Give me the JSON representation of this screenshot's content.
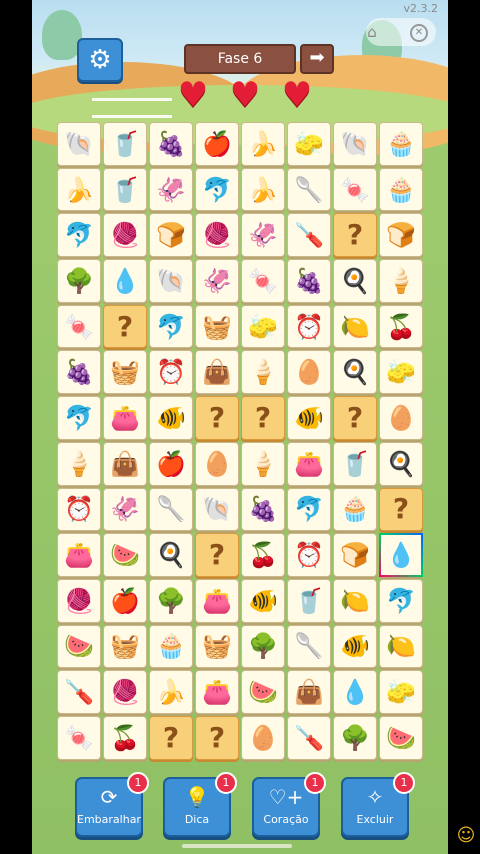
{
  "header": {
    "version": "v2.3.2",
    "level_label": "Fase 6",
    "settings_icon": "gear-icon",
    "next_icon": "arrow-right-icon",
    "hearts": 3
  },
  "board": {
    "rows": 14,
    "cols": 8,
    "tiles": [
      [
        "shell",
        "cup",
        "grapes",
        "apple",
        "banana",
        "sponge",
        "shell",
        "cupcake"
      ],
      [
        "banana",
        "cup",
        "squid",
        "dolphin",
        "banana",
        "spoon",
        "candy",
        "cupcake"
      ],
      [
        "dolphin",
        "yarn",
        "bread",
        "yarn",
        "squid",
        "screwdriver",
        "?",
        "bread"
      ],
      [
        "tree",
        "drop",
        "shell",
        "squid",
        "candy",
        "grapes",
        "pan",
        "popsicle"
      ],
      [
        "candy",
        "?",
        "dolphin",
        "basket",
        "sponge",
        "clock",
        "lemon",
        "cherry"
      ],
      [
        "grapes",
        "basket",
        "clock",
        "sack",
        "popsicle",
        "egg",
        "pan",
        "sponge"
      ],
      [
        "dolphin",
        "purse",
        "fish",
        "?",
        "?",
        "fish",
        "?",
        "egg"
      ],
      [
        "popsicle",
        "sack",
        "apple",
        "egg",
        "popsicle",
        "purse",
        "cup",
        "pan"
      ],
      [
        "clock",
        "squid",
        "spoon",
        "shell",
        "grapes",
        "dolphin",
        "cupcake",
        "?"
      ],
      [
        "purse",
        "melon",
        "pan",
        "?",
        "cherry",
        "clock",
        "bread",
        "drop"
      ],
      [
        "yarn",
        "apple",
        "tree",
        "purse",
        "fish",
        "cup",
        "lemon",
        "dolphin"
      ],
      [
        "melon",
        "basket",
        "cupcake",
        "basket",
        "tree",
        "spoon",
        "fish",
        "lemon"
      ],
      [
        "screwdriver",
        "yarn",
        "banana",
        "purse",
        "melon",
        "sack",
        "drop",
        "sponge"
      ],
      [
        "candy",
        "cherry",
        "?",
        "?",
        "egg",
        "screwdriver",
        "tree",
        "melon"
      ]
    ],
    "selected": [
      9,
      7
    ]
  },
  "icons": {
    "shell": "🐚",
    "cup": "🥤",
    "grapes": "🍇",
    "apple": "🍎",
    "banana": "🍌",
    "sponge": "🧽",
    "cupcake": "🧁",
    "squid": "🦑",
    "dolphin": "🐬",
    "spoon": "🥄",
    "candy": "🍬",
    "yarn": "🧶",
    "bread": "🍞",
    "screwdriver": "🪛",
    "?": "?",
    "tree": "🌳",
    "drop": "💧",
    "popsicle": "🍦",
    "basket": "🧺",
    "sack": "👜",
    "clock": "⏰",
    "lemon": "🍋",
    "cherry": "🍒",
    "pan": "🍳",
    "egg": "🥚",
    "purse": "👛",
    "fish": "🐠",
    "melon": "🍉"
  },
  "powerups": [
    {
      "label": "Embaralhar",
      "count": "1",
      "icon": "shuffle-icon"
    },
    {
      "label": "Dica",
      "count": "1",
      "icon": "lightbulb-icon"
    },
    {
      "label": "Coração",
      "count": "1",
      "icon": "heart-plus-icon"
    },
    {
      "label": "Excluir",
      "count": "1",
      "icon": "magic-wand-icon"
    }
  ]
}
